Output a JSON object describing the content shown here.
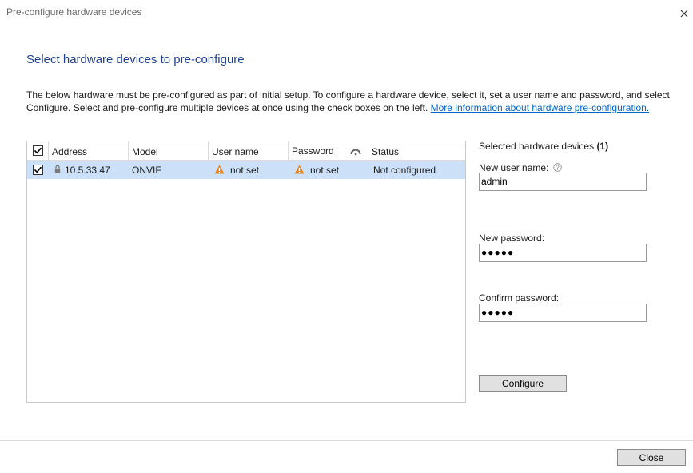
{
  "window": {
    "title": "Pre-configure hardware devices"
  },
  "heading": "Select hardware devices to pre-configure",
  "description": {
    "line1": "The below hardware must be pre-configured as part of initial setup. To configure a hardware device, select it, set a user name and password, and select",
    "line2": "Configure. Select and pre-configure multiple devices at once using the check boxes on the left.",
    "link": "More information about hardware pre-configuration."
  },
  "grid": {
    "columns": {
      "address": "Address",
      "model": "Model",
      "username": "User name",
      "password": "Password",
      "status": "Status"
    },
    "rows": [
      {
        "address": "10.5.33.47",
        "model": "ONVIF",
        "username": "not set",
        "password": "not set",
        "status": "Not configured"
      }
    ]
  },
  "side": {
    "header": "Selected hardware devices",
    "count": "(1)",
    "username_label": "New user name:",
    "username_value": "admin",
    "password_label": "New password:",
    "password_value": "●●●●●",
    "confirm_label": "Confirm password:",
    "confirm_value": "●●●●●",
    "configure_label": "Configure"
  },
  "footer": {
    "close_label": "Close"
  },
  "colors": {
    "accent": "#1f3f8f",
    "link": "#0066cc",
    "selection": "#cce0f7",
    "warning": "#e8821a"
  }
}
